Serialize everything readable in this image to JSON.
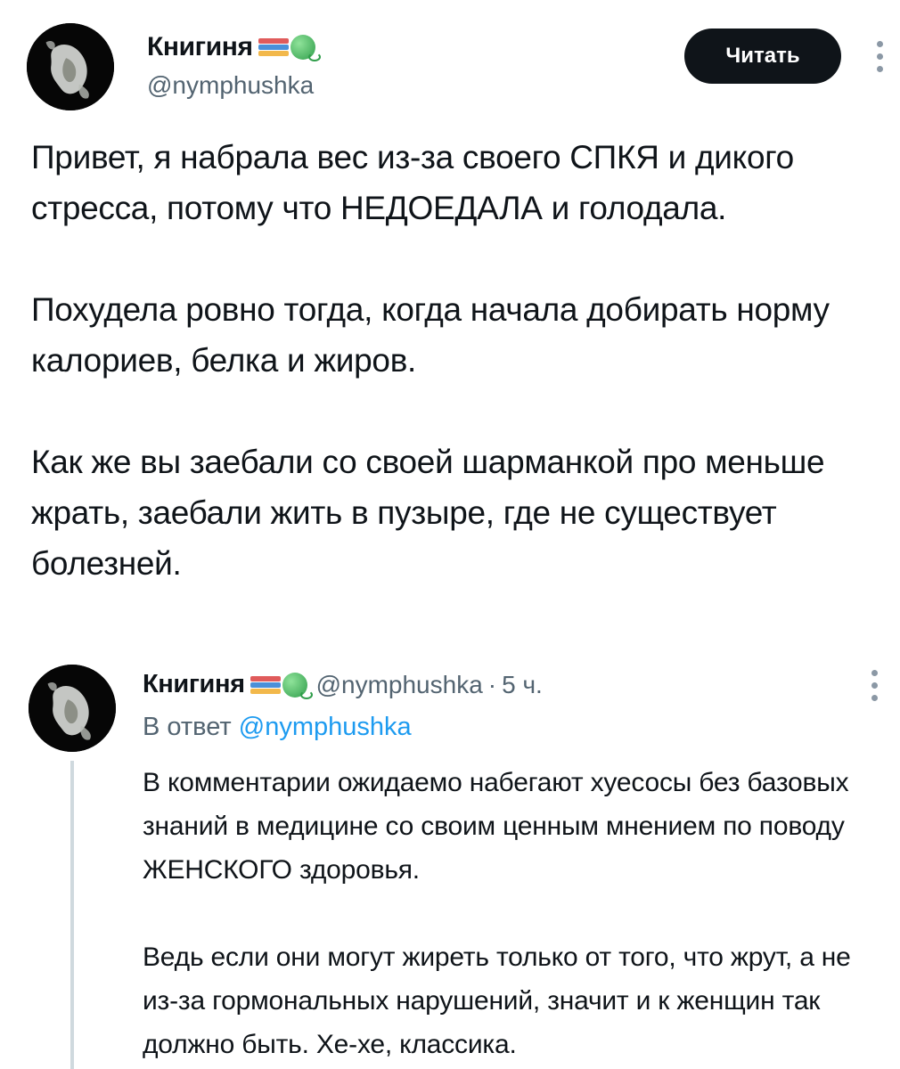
{
  "tweet": {
    "author": {
      "name": "Книгиня",
      "handle": "@nymphushka",
      "badge_emojis": [
        "books-emoji",
        "yarn-emoji"
      ]
    },
    "follow_label": "Читать",
    "paragraphs": [
      "Привет, я набрала вес из-за своего СПКЯ и дикого стресса, потому что НЕДОЕДАЛА и голодала.",
      "Похудела ровно тогда, когда начала добирать норму калориев, белка и жиров.",
      "Как же вы заебали со своей шарманкой про меньше жрать, заебали жить в пузыре, где не существует болезней."
    ]
  },
  "reply": {
    "author": {
      "name": "Книгиня",
      "handle": "@nymphushka"
    },
    "separator": "·",
    "time": "5 ч.",
    "reply_to_prefix": "В ответ",
    "reply_to_handle": "@nymphushka",
    "paragraphs": [
      "В комментарии ожидаемо набегают хуесосы без базовых знаний в медицине со своим ценным мнением по поводу ЖЕНСКОГО здоровья.",
      "Ведь если они могут жиреть только от того, что жрут, а не из-за гормональных нарушений, значит и к женщин так должно быть. Хе-хе, классика."
    ]
  },
  "colors": {
    "text": "#0f1419",
    "secondary": "#536471",
    "link": "#1d9bf0",
    "button_bg": "#0f1419"
  }
}
